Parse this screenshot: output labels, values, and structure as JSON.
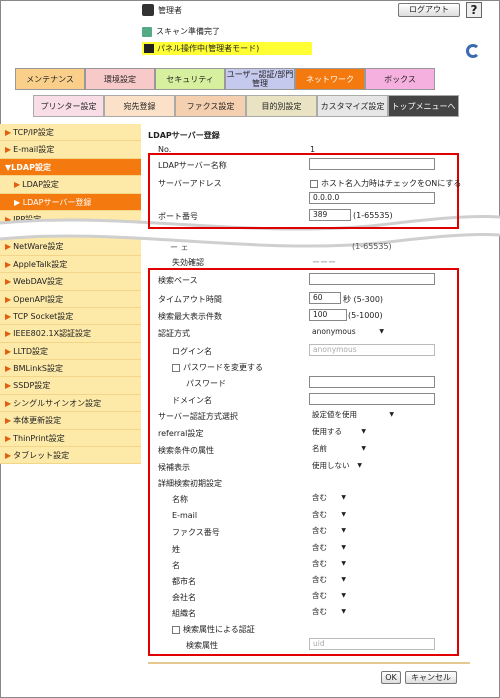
{
  "header": {
    "user_label": "管理者",
    "logout_label": "ログアウト",
    "help_label": "?",
    "scan_status": "スキャン準備完了",
    "panel_status": "パネル操作中(管理者モード)"
  },
  "tabs": [
    "メンテナンス",
    "環境設定",
    "セキュリティ",
    "ユーザー認証/部門管理",
    "ネットワーク",
    "ボックス"
  ],
  "subtabs": [
    "プリンター設定",
    "宛先登録",
    "ファクス設定",
    "目的別設定",
    "カスタマイズ設定",
    "トップメニューへ"
  ],
  "sidebar": [
    {
      "label": "TCP/IP設定",
      "state": "normal"
    },
    {
      "label": "E-mail設定",
      "state": "normal"
    },
    {
      "label": "LDAP設定",
      "state": "active"
    },
    {
      "label": "LDAP設定",
      "state": "sub"
    },
    {
      "label": "LDAPサーバー登録",
      "state": "subactive"
    },
    {
      "label": "IPP設定",
      "state": "normal"
    },
    {
      "label": "NetWare設定",
      "state": "normal"
    },
    {
      "label": "AppleTalk設定",
      "state": "normal"
    },
    {
      "label": "WebDAV設定",
      "state": "normal"
    },
    {
      "label": "OpenAPI設定",
      "state": "normal"
    },
    {
      "label": "TCP Socket設定",
      "state": "normal"
    },
    {
      "label": "IEEE802.1X認証設定",
      "state": "normal"
    },
    {
      "label": "LLTD設定",
      "state": "normal"
    },
    {
      "label": "BMLinkS設定",
      "state": "normal"
    },
    {
      "label": "SSDP設定",
      "state": "normal"
    },
    {
      "label": "シングルサインオン設定",
      "state": "normal"
    },
    {
      "label": "本体更新設定",
      "state": "normal"
    },
    {
      "label": "ThinPrint設定",
      "state": "normal"
    },
    {
      "label": "タブレット設定",
      "state": "normal"
    }
  ],
  "form": {
    "title": "LDAPサーバー登録",
    "no_label": "No.",
    "no_value": "1",
    "server_name_label": "LDAPサーバー名称",
    "server_addr_label": "サーバーアドレス",
    "host_check_label": "ホスト名入力時はチェックをONにする",
    "addr_value": "0.0.0.0",
    "port_label": "ポート番号",
    "port_value": "389",
    "port_range": "(1-65535)",
    "partial1": "ー ェ",
    "partial_range": "(1-65535)",
    "partial2": "失効確認",
    "partial3": "ーーー",
    "search_base_label": "検索ベース",
    "timeout_label": "タイムアウト時間",
    "timeout_value": "60",
    "timeout_unit": "秒 (5-300)",
    "max_results_label": "検索最大表示件数",
    "max_results_value": "100",
    "max_results_range": "(5-1000)",
    "auth_label": "認証方式",
    "auth_value": "anonymous",
    "login_label": "ログイン名",
    "login_placeholder": "anonymous",
    "change_pw_label": "パスワードを変更する",
    "password_label": "パスワード",
    "domain_label": "ドメイン名",
    "server_auth_label": "サーバー認証方式選択",
    "server_auth_value": "設定値を使用",
    "referral_label": "referral設定",
    "referral_value": "使用する",
    "attr_label": "検索条件の属性",
    "attr_value": "名前",
    "candidate_label": "候補表示",
    "candidate_value": "使用しない",
    "detail_label": "詳細検索初期設定",
    "details": [
      {
        "label": "名称",
        "value": "含む"
      },
      {
        "label": "E-mail",
        "value": "含む"
      },
      {
        "label": "ファクス番号",
        "value": "含む"
      },
      {
        "label": "姓",
        "value": "含む"
      },
      {
        "label": "名",
        "value": "含む"
      },
      {
        "label": "都市名",
        "value": "含む"
      },
      {
        "label": "会社名",
        "value": "含む"
      },
      {
        "label": "組織名",
        "value": "含む"
      }
    ],
    "search_attr_auth_label": "検索属性による認証",
    "search_attr_label": "検索属性",
    "search_attr_placeholder": "uid",
    "ok_label": "OK",
    "cancel_label": "キャンセル"
  },
  "colors": {
    "accent": "#f47a10",
    "sidebar_bg": "#fde9a8",
    "highlight": "#e00000"
  }
}
